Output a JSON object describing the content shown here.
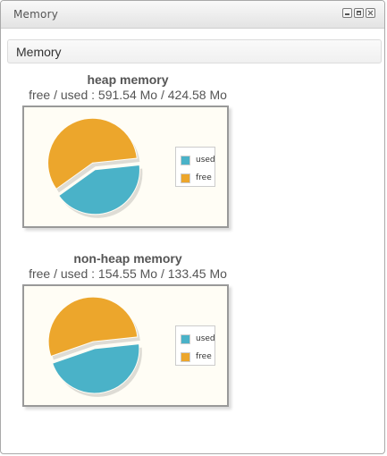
{
  "window": {
    "title": "Memory"
  },
  "section": {
    "title": "Memory"
  },
  "colors": {
    "used": "#4ab2c8",
    "free": "#eca62c"
  },
  "panels": [
    {
      "title": "heap memory",
      "subtitle": "free / used : 591.54 Mo / 424.58 Mo"
    },
    {
      "title": "non-heap memory",
      "subtitle": "free / used : 154.55 Mo / 133.45 Mo"
    }
  ],
  "chart_data": [
    {
      "type": "pie",
      "title": "heap memory",
      "categories": [
        "used",
        "free"
      ],
      "values": [
        424.58,
        591.54
      ],
      "legend": "right"
    },
    {
      "type": "pie",
      "title": "non-heap memory",
      "categories": [
        "used",
        "free"
      ],
      "values": [
        133.45,
        154.55
      ],
      "legend": "right"
    }
  ]
}
